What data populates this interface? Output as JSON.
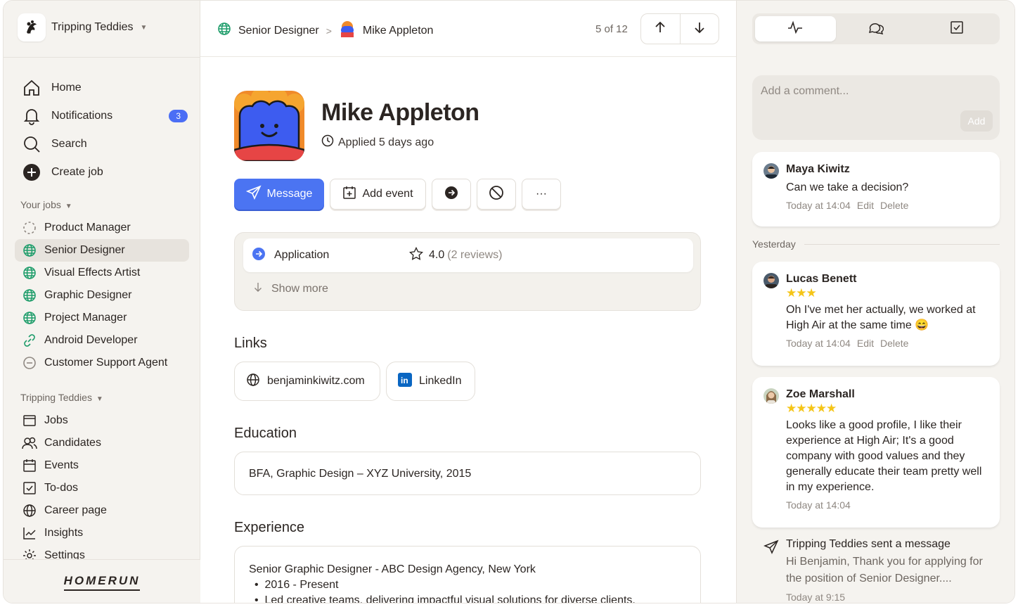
{
  "org": {
    "name": "Tripping Teddies"
  },
  "nav": [
    {
      "label": "Home",
      "icon": "home-icon"
    },
    {
      "label": "Notifications",
      "icon": "bell-icon",
      "badge": "3"
    },
    {
      "label": "Search",
      "icon": "search-icon"
    },
    {
      "label": "Create job",
      "icon": "plus-circle-icon"
    }
  ],
  "your_jobs": {
    "heading": "Your jobs",
    "items": [
      {
        "label": "Product Manager",
        "icon": "dashed-circle-icon"
      },
      {
        "label": "Senior Designer",
        "icon": "globe-icon",
        "active": true
      },
      {
        "label": "Visual Effects Artist",
        "icon": "globe-icon"
      },
      {
        "label": "Graphic Designer",
        "icon": "globe-icon"
      },
      {
        "label": "Project Manager",
        "icon": "globe-icon"
      },
      {
        "label": "Android Developer",
        "icon": "link-icon"
      },
      {
        "label": "Customer Support Agent",
        "icon": "minus-circle-icon"
      }
    ]
  },
  "org_nav": {
    "heading": "Tripping Teddies",
    "items": [
      {
        "label": "Jobs",
        "icon": "briefcase-icon"
      },
      {
        "label": "Candidates",
        "icon": "users-icon"
      },
      {
        "label": "Events",
        "icon": "calendar-icon"
      },
      {
        "label": "To-dos",
        "icon": "checkbox-icon"
      },
      {
        "label": "Career page",
        "icon": "globe-icon"
      },
      {
        "label": "Insights",
        "icon": "chart-icon"
      },
      {
        "label": "Settings",
        "icon": "gear-icon"
      }
    ]
  },
  "footer": {
    "brand": "HOMERUN"
  },
  "breadcrumb": {
    "job": "Senior Designer",
    "candidate": "Mike Appleton"
  },
  "pager": {
    "text": "5 of 12"
  },
  "candidate": {
    "name": "Mike Appleton",
    "applied": "Applied 5 days ago"
  },
  "actions": {
    "message": "Message",
    "add_event": "Add event",
    "more": "···"
  },
  "application": {
    "label": "Application",
    "rating": "4.0",
    "reviews": "(2 reviews)",
    "show_more": "Show more"
  },
  "links": {
    "heading": "Links",
    "items": [
      {
        "label": "benjaminkiwitz.com",
        "icon": "globe-icon"
      },
      {
        "label": "LinkedIn",
        "icon": "linkedin-icon"
      }
    ]
  },
  "education": {
    "heading": "Education",
    "text": "BFA, Graphic Design – XYZ University, 2015"
  },
  "experience": {
    "heading": "Experience",
    "title": "Senior Graphic Designer - ABC Design Agency, New York",
    "bullets": [
      "2016 - Present",
      "Led creative teams, delivering impactful visual solutions for diverse clients."
    ]
  },
  "right_tabs": [
    "activity-icon",
    "chat-icon",
    "checkbox-icon"
  ],
  "comment_input": {
    "placeholder": "Add a comment...",
    "add": "Add"
  },
  "comments": [
    {
      "name": "Maya Kiwitz",
      "text": "Can we take a decision?",
      "time": "Today at 14:04",
      "edit": "Edit",
      "delete": "Delete"
    },
    {
      "name": "Lucas Benett",
      "stars": "★★★",
      "stars_count": 3,
      "text": "Oh I've met her actually, we worked at High Air at the same time 😄",
      "time": "Today at 14:04",
      "edit": "Edit",
      "delete": "Delete"
    },
    {
      "name": "Zoe Marshall",
      "stars": "★★★★★",
      "stars_count": 5,
      "text": "Looks like a good profile, I like their experience at High Air; It's a good company with good values and they generally educate their team pretty well in my experience.",
      "time": "Today at 14:04"
    }
  ],
  "divider": "Yesterday",
  "message": {
    "title": "Tripping Teddies sent a message",
    "body": "Hi Benjamin, Thank you for applying for the position of Senior Designer....",
    "time": "Today at 9:15"
  },
  "colors": {
    "accent": "#4b74f2",
    "green": "#1f9d6b",
    "star": "#f5c518",
    "badge": "#4b6ef5"
  }
}
